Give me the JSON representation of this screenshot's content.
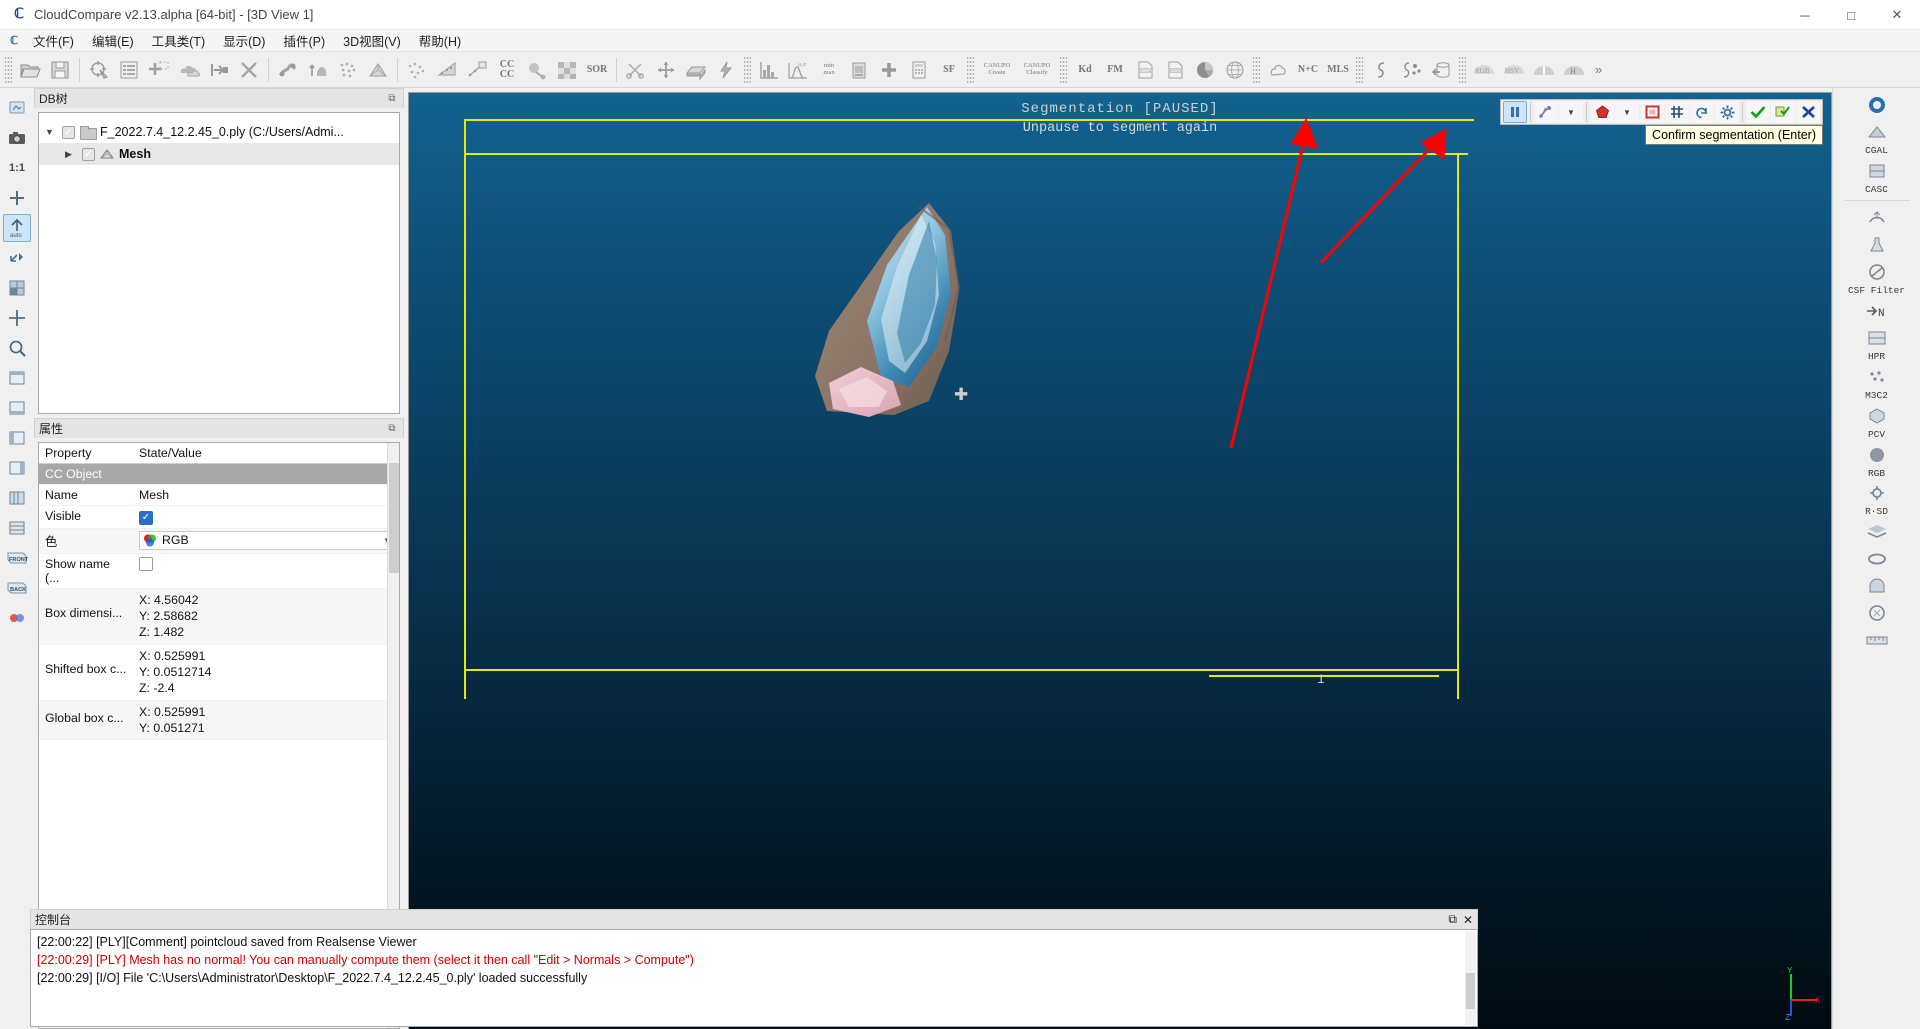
{
  "window": {
    "app_icon": "cloudcompare-logo-icon",
    "title": "CloudCompare v2.13.alpha [64-bit] - [3D View 1]",
    "minimize_label": "─",
    "maximize_label": "□",
    "close_label": "✕"
  },
  "menu": {
    "items": [
      {
        "label": "文件(F)",
        "mnemonic": "F"
      },
      {
        "label": "编辑(E)",
        "mnemonic": "E"
      },
      {
        "label": "工具类(T)",
        "mnemonic": "T"
      },
      {
        "label": "显示(D)",
        "mnemonic": "D"
      },
      {
        "label": "插件(P)",
        "mnemonic": "P"
      },
      {
        "label": "3D视图(V)",
        "mnemonic": "V"
      },
      {
        "label": "帮助(H)",
        "mnemonic": "H"
      }
    ]
  },
  "toolbar": {
    "overflow_label": "»",
    "buttons": [
      {
        "name": "open-file-icon"
      },
      {
        "name": "save-file-icon"
      },
      {
        "name": "pick-rotation-center-icon"
      },
      {
        "name": "properties-list-icon"
      },
      {
        "name": "add-point-icon"
      },
      {
        "name": "clone-cloud-icon"
      },
      {
        "name": "merge-icon"
      },
      {
        "name": "delete-icon"
      },
      {
        "name": "normals-compute-icon"
      },
      {
        "name": "normals-orient-icon"
      },
      {
        "name": "subsample-icon"
      },
      {
        "name": "mesh-delaunay-icon"
      },
      {
        "name": "sample-points-icon"
      },
      {
        "name": "fit-plane-icon"
      },
      {
        "name": "fit-quadric-icon"
      },
      {
        "name": "cloud-cloud-dist-icon",
        "text": "CC\nCC"
      },
      {
        "name": "cloud-mesh-dist-icon"
      },
      {
        "name": "noise-filter-icon"
      },
      {
        "name": "sor-filter-icon",
        "text": "SOR"
      },
      {
        "name": "segment-scissors-icon"
      },
      {
        "name": "translate-rotate-icon"
      },
      {
        "name": "crop-box-icon"
      },
      {
        "name": "lightning-icon"
      },
      {
        "name": "histogram-icon"
      },
      {
        "name": "gaussian-stats-icon",
        "text": "μ,σ"
      },
      {
        "name": "min-max-filter-icon",
        "text": "min\nmax"
      },
      {
        "name": "color-scale-icon"
      },
      {
        "name": "add-scalar-field-icon",
        "text": "+"
      },
      {
        "name": "sf-calculator-icon"
      },
      {
        "name": "sf-gradient-icon",
        "text": "SF"
      },
      {
        "name": "canupo-create-icon",
        "text": "CANUPO\nCreate"
      },
      {
        "name": "canupo-classify-icon",
        "text": "CANUPO\nClassify"
      },
      {
        "name": "kd-tree-icon",
        "text": "Kd"
      },
      {
        "name": "facet-matching-icon",
        "text": "FM"
      },
      {
        "name": "shp-export-icon",
        "text": "SHP"
      },
      {
        "name": "csv-export-icon",
        "text": "CSV"
      },
      {
        "name": "pie-chart-icon"
      },
      {
        "name": "globe-icon"
      },
      {
        "name": "poisson-recon-icon"
      },
      {
        "name": "normal-plus-curvature-icon",
        "text": "N+C"
      },
      {
        "name": "mls-smoothing-icon",
        "text": "MLS"
      },
      {
        "name": "curve-fit-icon"
      },
      {
        "name": "curve-points-icon"
      },
      {
        "name": "cylinder-unroll-icon"
      },
      {
        "name": "rgb-filter-icon",
        "text": "RGB"
      },
      {
        "name": "hsv-filter-icon",
        "text": "HSV"
      },
      {
        "name": "contrast-enhance-icon"
      },
      {
        "name": "histogram-equalize-icon"
      }
    ]
  },
  "left_tools": {
    "buttons": [
      {
        "name": "global-zoom-icon",
        "glyph": "▣"
      },
      {
        "name": "camera-snapshot-icon",
        "glyph": "◉"
      },
      {
        "name": "zoom-1to1-icon",
        "glyph": "1:1",
        "text": true
      },
      {
        "name": "set-pivot-icon",
        "glyph": "✚"
      },
      {
        "name": "auto-pick-icon",
        "glyph": "auto",
        "text": true,
        "active": true
      },
      {
        "name": "toggle-sun-light-icon",
        "glyph": "⤡"
      },
      {
        "name": "toggle-custom-light-icon",
        "glyph": "◧"
      },
      {
        "name": "point-picking-icon",
        "glyph": "✥"
      },
      {
        "name": "zoom-box-icon",
        "glyph": "⌕"
      },
      {
        "name": "view-top-icon",
        "glyph": "□"
      },
      {
        "name": "view-bottom-icon",
        "glyph": "▧"
      },
      {
        "name": "view-front-icon",
        "glyph": "▤"
      },
      {
        "name": "view-back-icon",
        "glyph": "▥"
      },
      {
        "name": "view-left-icon",
        "glyph": "▨"
      },
      {
        "name": "view-right-icon",
        "glyph": "▩"
      },
      {
        "name": "front-view-label-icon",
        "glyph": "FRONT",
        "text": true
      },
      {
        "name": "back-view-label-icon",
        "glyph": "BACK",
        "text": true
      },
      {
        "name": "stereo-mode-icon",
        "glyph": "●●"
      }
    ]
  },
  "db_tree": {
    "panel_title": "DB树",
    "float_button": "⧉",
    "items": [
      {
        "label": "F_2022.7.4_12.2.45_0.ply (C:/Users/Admi...",
        "expanded": true,
        "checked": true,
        "icon": "folder-icon"
      },
      {
        "label": "Mesh",
        "checked": true,
        "selected": true,
        "icon": "mesh-icon"
      }
    ]
  },
  "properties": {
    "panel_title": "属性",
    "float_button": "⧉",
    "columns": [
      "Property",
      "State/Value"
    ],
    "section_label": "CC Object",
    "rows": [
      {
        "property": "Name",
        "value": "Mesh",
        "type": "text"
      },
      {
        "property": "Visible",
        "value": "",
        "type": "checkbox",
        "checked": true
      },
      {
        "property": "色",
        "value": "RGB",
        "type": "combo"
      },
      {
        "property": "Show name (...",
        "value": "",
        "type": "checkbox",
        "checked": false
      },
      {
        "property": "Box dimensi...",
        "value": "X: 4.56042\nY: 2.58682\nZ: 1.482",
        "type": "multiline"
      },
      {
        "property": "Shifted box c...",
        "value": "X: 0.525991\nY: 0.0512714\nZ: -2.4",
        "type": "multiline"
      },
      {
        "property": "Global box c...",
        "value": "X: 0.525991\nY: 0.051271",
        "type": "multiline"
      }
    ]
  },
  "view3d": {
    "segmentation_title": "Segmentation [PAUSED]",
    "segmentation_hint": "Unpause to segment again",
    "scale_label": "1",
    "axis": {
      "x": "X",
      "y": "Y",
      "z": "Z"
    },
    "tooltip": "Confirm segmentation (Enter)",
    "segmentation_toolbar": [
      {
        "name": "pause-segmentation-button",
        "glyph": "❙❙",
        "selected": true
      },
      {
        "name": "select-tool-button",
        "glyph": "✦"
      },
      {
        "name": "select-tool-dropdown",
        "glyph": "▾"
      },
      {
        "name": "polyline-selection-button",
        "glyph": "⬠"
      },
      {
        "name": "polyline-dropdown",
        "glyph": "▾"
      },
      {
        "name": "segment-in-button",
        "glyph": "⬟"
      },
      {
        "name": "segment-out-button",
        "glyph": "▣"
      },
      {
        "name": "razor-grid-button",
        "glyph": "#"
      },
      {
        "name": "undo-button",
        "glyph": "↺"
      },
      {
        "name": "settings-button",
        "glyph": "⚙"
      },
      {
        "name": "confirm-segmentation-button",
        "glyph": "✔"
      },
      {
        "name": "confirm-and-delete-button",
        "glyph": "⧉"
      },
      {
        "name": "cancel-segmentation-button",
        "glyph": "✖"
      }
    ],
    "colors": {
      "selection_box": "#e8e800",
      "accent_green": "#1e9e1e",
      "accent_red": "#d00000",
      "annotation_arrow": "#ff0000"
    }
  },
  "right_rail": {
    "buttons": [
      {
        "name": "ccviewer-icon",
        "glyph": "◎",
        "label": ""
      },
      {
        "name": "cgal-plugin-icon",
        "glyph": "◰",
        "label": "CGAL"
      },
      {
        "name": "casc-plugin-icon",
        "glyph": "◱",
        "label": "CASC"
      },
      {
        "name": "hough-normals-icon",
        "glyph": "☵",
        "label": ""
      },
      {
        "name": "cork-boolean-icon",
        "glyph": "⚗",
        "label": ""
      },
      {
        "name": "csf-filter-icon",
        "glyph": "⊘",
        "label": "CSF Filter"
      },
      {
        "name": "normals-to-n-icon",
        "glyph": "N",
        "label": "→ N"
      },
      {
        "name": "hpr-icon",
        "glyph": "▤",
        "label": "HPR"
      },
      {
        "name": "m3c2-icon",
        "glyph": "∴",
        "label": "M3C2"
      },
      {
        "name": "pcv-icon",
        "glyph": "⬟",
        "label": "PCV"
      },
      {
        "name": "qcsv-icon",
        "glyph": "●",
        "label": "RGB"
      },
      {
        "name": "rans-sd-icon",
        "glyph": "⚙",
        "label": "R·SD"
      },
      {
        "name": "layers-icon",
        "glyph": "≡",
        "label": ""
      },
      {
        "name": "ellipse-fit-icon",
        "glyph": "⬭",
        "label": ""
      },
      {
        "name": "tunnel-icon",
        "glyph": "∩",
        "label": ""
      },
      {
        "name": "compass-icon",
        "glyph": "⦿",
        "label": ""
      },
      {
        "name": "ruler-icon",
        "glyph": "▭",
        "label": ""
      }
    ]
  },
  "console": {
    "panel_title": "控制台",
    "float_button": "⧉",
    "close_button": "✕",
    "lines": [
      {
        "text": "[22:00:22] [PLY][Comment] pointcloud saved from Realsense Viewer",
        "level": "normal"
      },
      {
        "text": "[22:00:29] [PLY] Mesh has no normal! You can manually compute them (select it then call \"Edit > Normals > Compute\")",
        "level": "error"
      },
      {
        "text": "[22:00:29] [I/O] File 'C:\\Users\\Administrator\\Desktop\\F_2022.7.4_12.2.45_0.ply' loaded successfully",
        "level": "normal"
      }
    ]
  }
}
